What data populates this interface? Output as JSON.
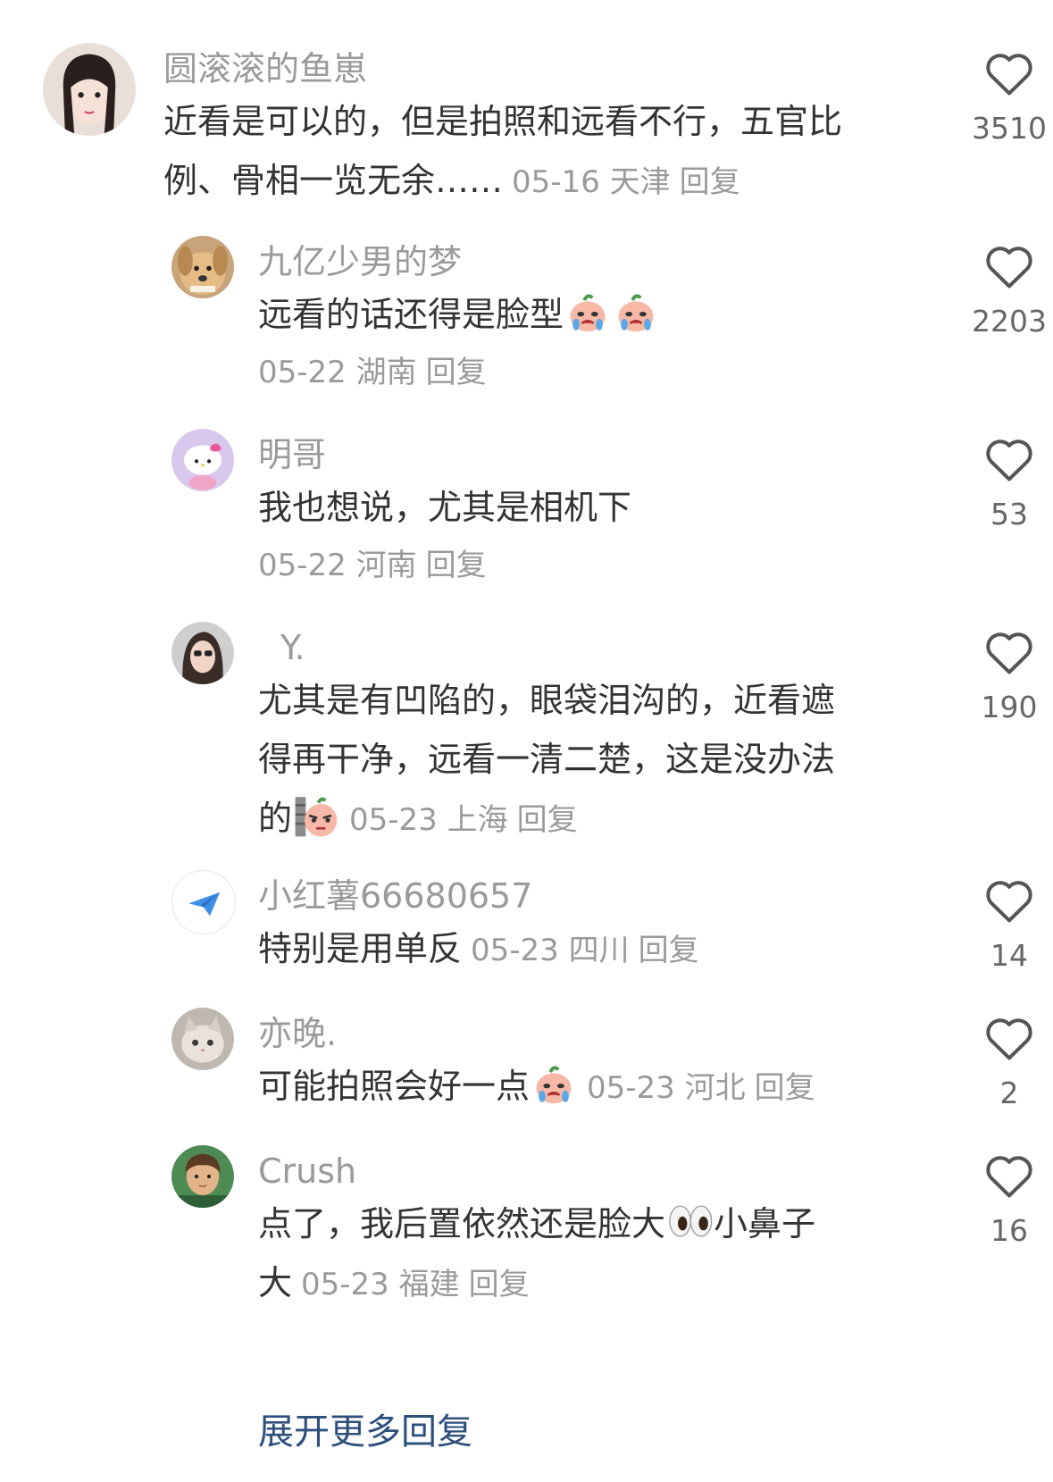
{
  "comments": [
    {
      "username": "圆滚滚的鱼崽",
      "text": "近看是可以的，但是拍照和远看不行，五官比例、骨相一览无余……",
      "date": "05-16",
      "location": "天津",
      "reply_label": "回复",
      "likes": "3510",
      "avatar": "girl-avatar"
    },
    {
      "username": "九亿少男的梦",
      "text": "远看的话还得是脸型",
      "emoji": [
        "crying-peach-emoji",
        "crying-peach-emoji"
      ],
      "date": "05-22",
      "location": "湖南",
      "reply_label": "回复",
      "likes": "2203",
      "avatar": "dog-avatar"
    },
    {
      "username": "明哥",
      "text": "我也想说，尤其是相机下",
      "date": "05-22",
      "location": "河南",
      "reply_label": "回复",
      "likes": "53",
      "avatar": "hello-kitty-avatar"
    },
    {
      "username": "Y.",
      "text_lines": [
        "尤其是有凹陷的，眼袋泪沟的，近看遮",
        "得再干净，远看一清二楚，这是没办法",
        "的"
      ],
      "emoji": [
        "peeking-peach-emoji"
      ],
      "date": "05-23",
      "location": "上海",
      "reply_label": "回复",
      "likes": "190",
      "avatar": "woman-avatar"
    },
    {
      "username": "小红薯66680657",
      "text": "特别是用单反",
      "date": "05-23",
      "location": "四川",
      "reply_label": "回复",
      "likes": "14",
      "avatar": "paper-plane-avatar"
    },
    {
      "username": "亦晚.",
      "text": "可能拍照会好一点",
      "emoji": [
        "crying-peach-emoji"
      ],
      "date": "05-23",
      "location": "河北",
      "reply_label": "回复",
      "likes": "2",
      "avatar": "cat-avatar"
    },
    {
      "username": "Crush",
      "text_lines": [
        "点了，我后置依然还是脸大",
        "小鼻子",
        "大"
      ],
      "emoji": [
        "eyes-emoji"
      ],
      "date": "05-23",
      "location": "福建",
      "reply_label": "回复",
      "likes": "16",
      "avatar": "cartoon-boy-avatar"
    }
  ],
  "expand_label": "展开更多回复",
  "colors": {
    "meta": "#9a9a9a",
    "text": "#333333",
    "link": "#2c4f7c"
  }
}
